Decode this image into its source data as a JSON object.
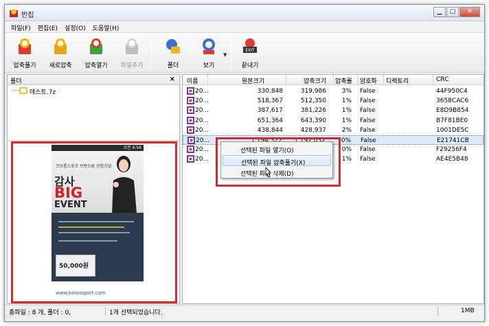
{
  "window": {
    "title": "반집"
  },
  "menu": [
    "파일(F)",
    "편집(E)",
    "설정(O)",
    "도움말(H)"
  ],
  "toolbar": [
    {
      "label": "압축풀기",
      "icon": "extract-icon",
      "enabled": true
    },
    {
      "label": "새로압축",
      "icon": "new-archive-icon",
      "enabled": true
    },
    {
      "label": "압축열기",
      "icon": "open-archive-icon",
      "enabled": true
    },
    {
      "label": "파일추가",
      "icon": "add-file-icon",
      "enabled": false
    },
    {
      "label": "폴더",
      "icon": "folder-icon",
      "enabled": true
    },
    {
      "label": "보기",
      "icon": "view-icon",
      "enabled": true
    },
    {
      "label": "끝내기",
      "icon": "exit-icon",
      "enabled": true
    }
  ],
  "folder_panel": {
    "title": "폴더",
    "close": "×",
    "tree_item": "테스트.7z"
  },
  "preview": {
    "status_time": "오전 9:56",
    "line1": "코오롱스포츠 브랜드상 선정기념",
    "big1": "감사",
    "big2": "BIG",
    "big3": "EVENT",
    "coupon": "50,000원",
    "url": "www.kolonsport.com"
  },
  "columns": [
    "이름",
    "원본크기",
    "압축크기",
    "압축률",
    "암호화",
    "디렉토리",
    "CRC"
  ],
  "files": [
    {
      "name": "20...",
      "size": "330,848",
      "packed": "319,986",
      "ratio": "3%",
      "enc": "False",
      "crc": "44F950C4"
    },
    {
      "name": "20...",
      "size": "518,367",
      "packed": "512,350",
      "ratio": "1%",
      "enc": "False",
      "crc": "3658CAC6"
    },
    {
      "name": "20...",
      "size": "387,617",
      "packed": "381,226",
      "ratio": "1%",
      "enc": "False",
      "crc": "E8D9B854"
    },
    {
      "name": "20...",
      "size": "651,364",
      "packed": "643,390",
      "ratio": "1%",
      "enc": "False",
      "crc": "B7F81BE0"
    },
    {
      "name": "20...",
      "size": "438,844",
      "packed": "428,937",
      "ratio": "2%",
      "enc": "False",
      "crc": "1001DE5C"
    },
    {
      "name": "20...",
      "size": "1,194,322",
      "packed": "1,192,032",
      "ratio": "0%",
      "enc": "False",
      "crc": "E21741CB"
    },
    {
      "name": "20...",
      "size": "",
      "packed": "",
      "ratio": "0%",
      "enc": "False",
      "crc": "F29256F4"
    },
    {
      "name": "20...",
      "size": "",
      "packed": "",
      "ratio": "1%",
      "enc": "False",
      "crc": "AE4E5B48"
    }
  ],
  "selected_row": 5,
  "context_menu": [
    "선택된 파일 열기(O)",
    "선택된 파일 압축풀기(X)",
    "선택된 파일 삭제(D)"
  ],
  "context_hover_index": 1,
  "status": {
    "left": "총파일 : 8 개, 폴더 : 0,",
    "middle": "1개 선택되었습니다.",
    "right": "1MB"
  },
  "colors": {
    "highlight_frame": "#d62b2b",
    "selection": "#dcebfc"
  }
}
